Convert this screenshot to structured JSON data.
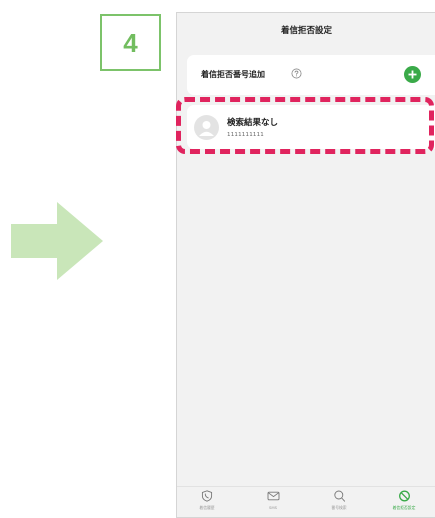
{
  "step": {
    "number": "4"
  },
  "screen": {
    "title": "着信拒否設定",
    "add_row": {
      "label": "着信拒否番号追加"
    },
    "result": {
      "name": "検索結果なし",
      "number": "1111111111"
    }
  },
  "tabbar": {
    "tabs": [
      {
        "label": "着信履歴",
        "icon": "phone-shield-icon",
        "active": false
      },
      {
        "label": "SMS",
        "icon": "mail-icon",
        "active": false
      },
      {
        "label": "番号検索",
        "icon": "search-icon",
        "active": false
      },
      {
        "label": "着信拒否設定",
        "icon": "block-icon",
        "active": true
      }
    ]
  },
  "colors": {
    "accent_green": "#3aaa49",
    "badge_green": "#7cc36a",
    "arrow_green": "#c9e6b9",
    "highlight_red": "#e0245e"
  }
}
